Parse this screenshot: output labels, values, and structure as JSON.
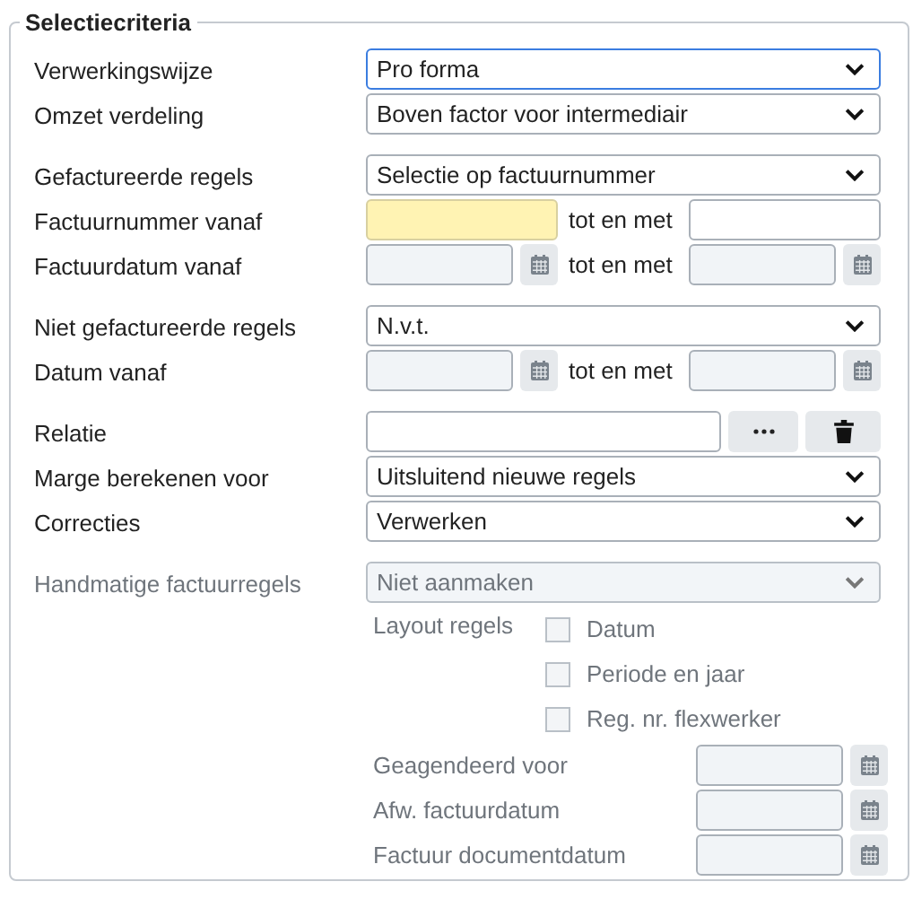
{
  "fieldset": {
    "legend": "Selectiecriteria"
  },
  "groups": [
    {
      "rows": [
        {
          "kind": "select",
          "label": "Verwerkingswijze",
          "value": "Pro forma",
          "focused": true,
          "disabled": false
        },
        {
          "kind": "select",
          "label": "Omzet verdeling",
          "value": "Boven factor voor intermediair",
          "focused": false,
          "disabled": false
        }
      ]
    },
    {
      "rows": [
        {
          "kind": "select",
          "label": "Gefactureerde regels",
          "value": "Selectie op factuurnummer",
          "focused": false,
          "disabled": false
        },
        {
          "kind": "range",
          "label": "Factuurnummer vanaf",
          "separator": "tot en met",
          "highlighted": true
        },
        {
          "kind": "date_range",
          "label": "Factuurdatum vanaf",
          "separator": "tot en met"
        }
      ]
    },
    {
      "rows": [
        {
          "kind": "select",
          "label": "Niet gefactureerde regels",
          "value": "N.v.t.",
          "focused": false,
          "disabled": false
        },
        {
          "kind": "date_range",
          "label": "Datum vanaf",
          "separator": "tot en met"
        }
      ]
    },
    {
      "rows": [
        {
          "kind": "lookup",
          "label": "Relatie"
        },
        {
          "kind": "select",
          "label": "Marge berekenen voor",
          "value": "Uitsluitend nieuwe regels",
          "focused": false,
          "disabled": false
        },
        {
          "kind": "select",
          "label": "Correcties",
          "value": "Verwerken",
          "focused": false,
          "disabled": false
        }
      ]
    },
    {
      "rows": [
        {
          "kind": "select",
          "label": "Handmatige factuurregels",
          "value": "Niet aanmaken",
          "focused": false,
          "disabled": true
        }
      ]
    }
  ],
  "layout": {
    "disabled": true,
    "label": "Layout regels",
    "checkboxes": [
      {
        "label": "Datum",
        "checked": false
      },
      {
        "label": "Periode en jaar",
        "checked": false
      },
      {
        "label": "Reg. nr. flexwerker",
        "checked": false
      }
    ],
    "dates": [
      {
        "label": "Geagendeerd voor"
      },
      {
        "label": "Afw. factuurdatum"
      },
      {
        "label": "Factuur documentdatum"
      }
    ]
  }
}
